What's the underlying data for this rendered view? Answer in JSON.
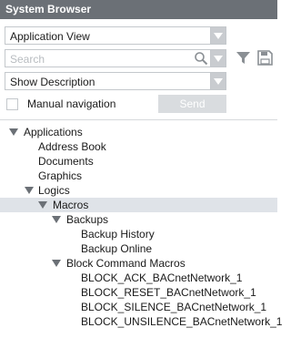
{
  "title": "System Browser",
  "view_select": {
    "value": "Application View"
  },
  "search": {
    "placeholder": "Search"
  },
  "description_select": {
    "value": "Show Description"
  },
  "manual_navigation": {
    "label": "Manual navigation",
    "checked": false
  },
  "send_button": {
    "label": "Send"
  },
  "icons": {
    "dropdown": "chevron-down-icon",
    "search": "magnifier-icon",
    "filter": "funnel-icon",
    "save": "floppy-disk-icon"
  },
  "colors": {
    "titlebar": "#6b7076",
    "selected_row": "#dfe3e8",
    "dropdown_button": "#c9ccd0",
    "disabled_button": "#d9dcdf"
  },
  "tree": {
    "applications": "Applications",
    "address_book": "Address Book",
    "documents": "Documents",
    "graphics": "Graphics",
    "logics": "Logics",
    "macros": "Macros",
    "backups": "Backups",
    "backup_history": "Backup History",
    "backup_online": "Backup Online",
    "block_command_macros": "Block Command Macros",
    "block_ack": "BLOCK_ACK_BACnetNetwork_1",
    "block_reset": "BLOCK_RESET_BACnetNetwork_1",
    "block_silence": "BLOCK_SILENCE_BACnetNetwork_1",
    "block_unsilence": "BLOCK_UNSILENCE_BACnetNetwork_1"
  }
}
